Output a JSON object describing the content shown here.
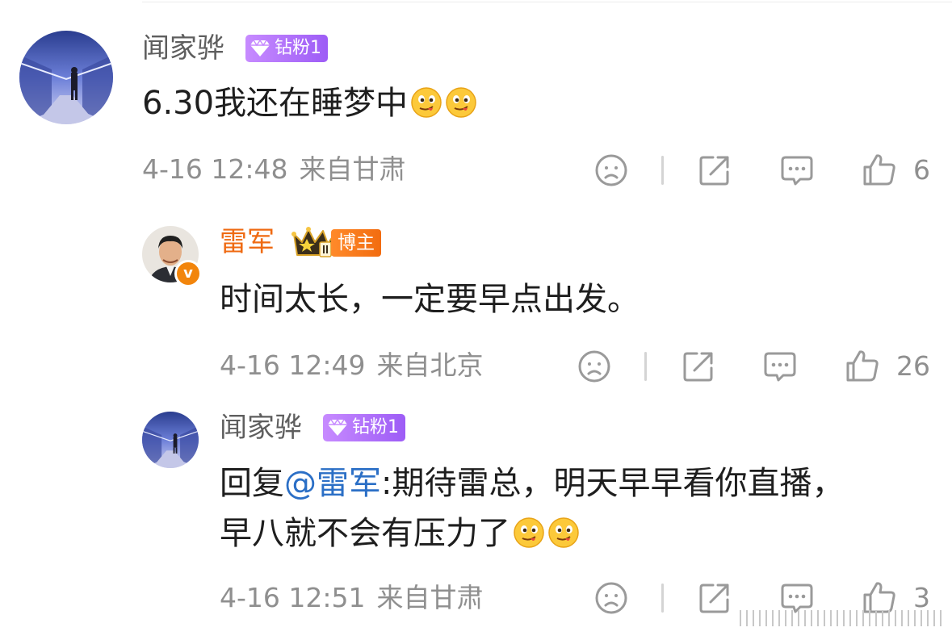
{
  "comments": [
    {
      "user": "闻家骅",
      "badge": "钻粉1",
      "text": "6.30我还在睡梦中",
      "emojis": [
        "drool-emoji",
        "drool-emoji"
      ],
      "time": "4-16 12:48",
      "location": "来自甘肃",
      "likes": "6"
    },
    {
      "user": "雷军",
      "badge": "博主",
      "verified_mark": "v",
      "text": "时间太长，一定要早点出发。",
      "time": "4-16 12:49",
      "location": "来自北京",
      "likes": "26"
    },
    {
      "user": "闻家骅",
      "badge": "钻粉1",
      "reply_prefix": "回复",
      "mention": "@雷军",
      "text_line1": ":期待雷总，明天早早看你直播，",
      "text_line2": "早八就不会有压力了",
      "emojis": [
        "drool-emoji",
        "drool-emoji"
      ],
      "time": "4-16 12:51",
      "location": "来自甘肃",
      "likes": "3"
    }
  ],
  "icons": {
    "dislike": "sad-face-icon",
    "share": "share-icon",
    "reply": "comment-icon",
    "like": "thumbs-up-icon"
  },
  "colors": {
    "vip_name": "#ef6a12",
    "mention": "#2b6fc6",
    "meta": "#8f8f8f",
    "badge_diamond": "#a765f7",
    "badge_bozhu": "#f26c10"
  }
}
